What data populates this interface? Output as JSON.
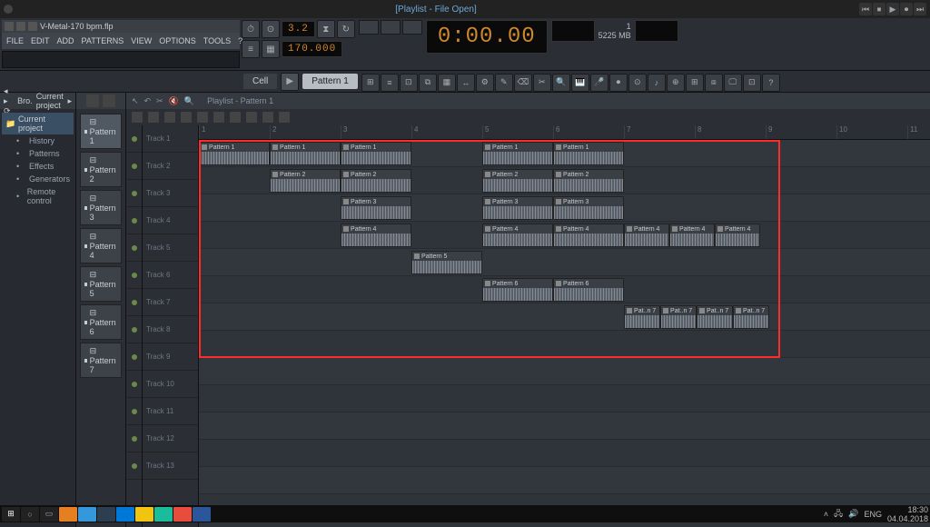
{
  "title": "[Playlist - File Open]",
  "file": {
    "name": "V-Metal-170 bpm.flp"
  },
  "menu": [
    "FILE",
    "EDIT",
    "ADD",
    "PATTERNS",
    "VIEW",
    "OPTIONS",
    "TOOLS",
    "?"
  ],
  "transport": {
    "beat": "3.2",
    "tempo": "170.000",
    "time": "0:00.00",
    "snap": "Cell",
    "pattern": "Pattern 1",
    "voices_label": "1",
    "mem": "5225 MB"
  },
  "browser": {
    "tabs": [
      "Bro.",
      "Current project"
    ],
    "root": "Current project",
    "items": [
      {
        "label": "History",
        "icon": "clock"
      },
      {
        "label": "Patterns",
        "icon": "pattern"
      },
      {
        "label": "Effects",
        "icon": "fx"
      },
      {
        "label": "Generators",
        "icon": "gen"
      },
      {
        "label": "Remote control",
        "icon": "remote"
      }
    ]
  },
  "patterns": [
    "Pattern 1",
    "Pattern 2",
    "Pattern 3",
    "Pattern 4",
    "Pattern 5",
    "Pattern 6",
    "Pattern 7"
  ],
  "playlist": {
    "title": "Playlist - Pattern 1",
    "tracks": [
      "Track 1",
      "Track 2",
      "Track 3",
      "Track 4",
      "Track 5",
      "Track 6",
      "Track 7",
      "Track 8",
      "Track 9",
      "Track 10",
      "Track 11",
      "Track 12",
      "Track 13"
    ],
    "ruler_bars": 17,
    "clips": [
      {
        "track": 0,
        "start": 0,
        "len": 78,
        "label": "Pattern 1"
      },
      {
        "track": 0,
        "start": 78,
        "len": 78,
        "label": "Pattern 1"
      },
      {
        "track": 0,
        "start": 156,
        "len": 78,
        "label": "Pattern 1"
      },
      {
        "track": 0,
        "start": 312,
        "len": 78,
        "label": "Pattern 1"
      },
      {
        "track": 0,
        "start": 390,
        "len": 78,
        "label": "Pattern 1"
      },
      {
        "track": 1,
        "start": 78,
        "len": 78,
        "label": "Pattern 2"
      },
      {
        "track": 1,
        "start": 156,
        "len": 78,
        "label": "Pattern 2"
      },
      {
        "track": 1,
        "start": 312,
        "len": 78,
        "label": "Pattern 2"
      },
      {
        "track": 1,
        "start": 390,
        "len": 78,
        "label": "Pattern 2"
      },
      {
        "track": 2,
        "start": 156,
        "len": 78,
        "label": "Pattern 3"
      },
      {
        "track": 2,
        "start": 312,
        "len": 78,
        "label": "Pattern 3"
      },
      {
        "track": 2,
        "start": 390,
        "len": 78,
        "label": "Pattern 3"
      },
      {
        "track": 3,
        "start": 156,
        "len": 78,
        "label": "Pattern 4"
      },
      {
        "track": 3,
        "start": 312,
        "len": 78,
        "label": "Pattern 4"
      },
      {
        "track": 3,
        "start": 390,
        "len": 78,
        "label": "Pattern 4"
      },
      {
        "track": 3,
        "start": 468,
        "len": 50,
        "label": "Pattern 4"
      },
      {
        "track": 3,
        "start": 518,
        "len": 50,
        "label": "Pattern 4"
      },
      {
        "track": 3,
        "start": 568,
        "len": 50,
        "label": "Pattern 4"
      },
      {
        "track": 4,
        "start": 234,
        "len": 78,
        "label": "Pattern 5"
      },
      {
        "track": 5,
        "start": 312,
        "len": 78,
        "label": "Pattern 6"
      },
      {
        "track": 5,
        "start": 390,
        "len": 78,
        "label": "Pattern 6"
      },
      {
        "track": 6,
        "start": 468,
        "len": 40,
        "label": "Pat..n 7"
      },
      {
        "track": 6,
        "start": 508,
        "len": 40,
        "label": "Pat..n 7"
      },
      {
        "track": 6,
        "start": 548,
        "len": 40,
        "label": "Pat..n 7"
      },
      {
        "track": 6,
        "start": 588,
        "len": 40,
        "label": "Pat..n 7"
      }
    ]
  },
  "taskbar": {
    "lang": "ENG",
    "time": "18:30",
    "date": "04.04.2018"
  }
}
